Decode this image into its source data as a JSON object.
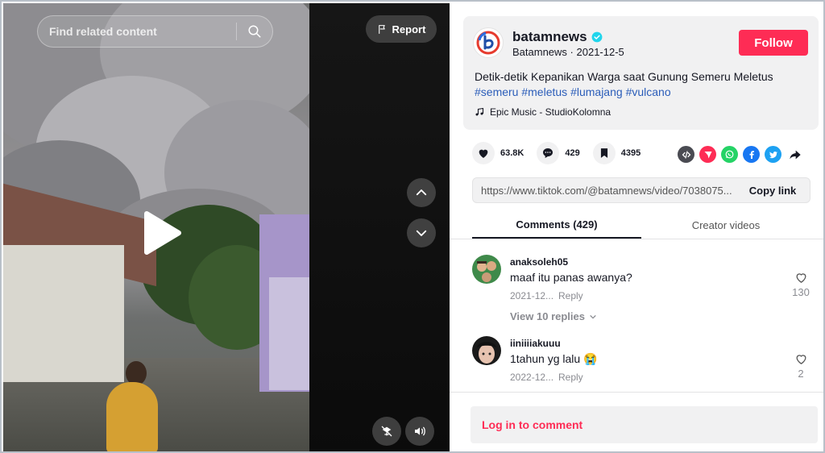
{
  "video": {
    "search": {
      "placeholder": "Find related content"
    },
    "report_label": "Report",
    "icons": {
      "search": "search-icon",
      "report": "flag-icon",
      "play": "play-icon",
      "up": "chevron-up-icon",
      "down": "chevron-down-icon",
      "pip": "floating-player-icon",
      "volume": "volume-icon"
    }
  },
  "post": {
    "username": "batamnews",
    "verified_icon": "verified-badge-icon",
    "nickname": "Batamnews",
    "date": "2021-12-5",
    "follow_label": "Follow",
    "caption_text": "Detik-detik Kepanikan Warga saat Gunung Semeru Meletus",
    "hashtags": [
      "#semeru",
      "#meletus",
      "#lumajang",
      "#vulcano"
    ],
    "music": "Epic Music - StudioKolomna"
  },
  "stats": {
    "likes": "63.8K",
    "comments": "429",
    "saves": "4395"
  },
  "share_icons": [
    "embed-icon",
    "send-icon",
    "whatsapp-icon",
    "facebook-icon",
    "twitter-icon",
    "share-arrow-icon"
  ],
  "link": {
    "url": "https://www.tiktok.com/@batamnews/video/7038075...",
    "copy_label": "Copy link"
  },
  "tabs": [
    {
      "label": "Comments (429)",
      "active": true
    },
    {
      "label": "Creator videos",
      "active": false
    }
  ],
  "comments": [
    {
      "user": "anaksoleh05",
      "text": "maaf itu panas awanya?",
      "date": "2021-12...",
      "reply_label": "Reply",
      "likes": "130",
      "view_replies": "View 10 replies"
    },
    {
      "user": "iiniiiiakuuu",
      "text": "1tahun yg lalu 😭",
      "date": "2022-12...",
      "reply_label": "Reply",
      "likes": "2"
    }
  ],
  "login_label": "Log in to comment",
  "colors": {
    "accent": "#fe2c55",
    "hashtag": "#2b5db9",
    "verified": "#20d5ec"
  }
}
